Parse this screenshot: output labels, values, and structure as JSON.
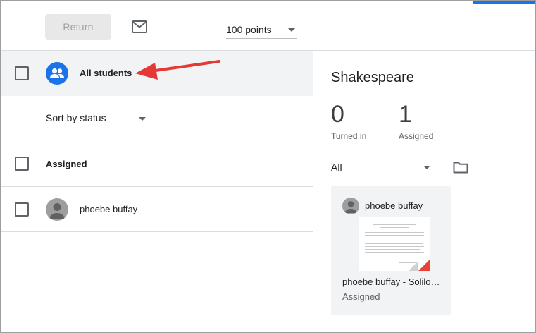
{
  "toolbar": {
    "return_label": "Return",
    "points_value": "100 points",
    "mail_icon": "mail-icon"
  },
  "roster": {
    "all_students_label": "All students",
    "sort_label": "Sort by status",
    "section_header": "Assigned",
    "students": [
      {
        "name": "phoebe buffay"
      }
    ]
  },
  "assignment": {
    "title": "Shakespeare",
    "turned_in_count": "0",
    "turned_in_label": "Turned in",
    "assigned_count": "1",
    "assigned_label": "Assigned",
    "filter_value": "All",
    "card": {
      "student_name": "phoebe buffay",
      "file_name": "phoebe buffay - Soliloquy",
      "status": "Assigned"
    }
  },
  "colors": {
    "accent": "#1a73e8",
    "annotation_arrow": "#e53935",
    "doc_badge": "#ea4335"
  }
}
